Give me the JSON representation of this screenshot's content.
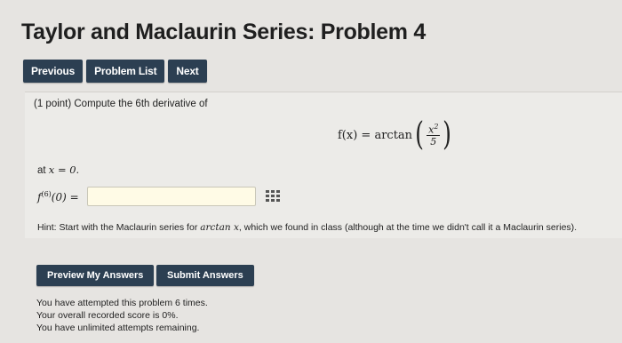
{
  "page": {
    "title": "Taylor and Maclaurin Series: Problem 4"
  },
  "nav": {
    "previous": "Previous",
    "problem_list": "Problem List",
    "next": "Next"
  },
  "problem": {
    "statement": "(1 point) Compute the 6th derivative of",
    "formula_lhs": "f(x) = arctan",
    "formula_num": "x",
    "formula_num_exp": "2",
    "formula_den": "5",
    "at_prefix": "at ",
    "at_var": "x = 0.",
    "answer_label_f": "f",
    "answer_label_exp": "(6)",
    "answer_label_rest": "(0) =",
    "answer_value": "",
    "hint_prefix": "Hint: Start with the Maclaurin series for ",
    "hint_math": "arctan x",
    "hint_suffix": ", which we found in class (although at the time we didn't call it a Maclaurin series)."
  },
  "actions": {
    "preview": "Preview My Answers",
    "submit": "Submit Answers"
  },
  "status": {
    "line1": "You have attempted this problem 6 times.",
    "line2": "Your overall recorded score is 0%.",
    "line3": "You have unlimited attempts remaining."
  },
  "icons": {
    "equation_editor": "grid-icon"
  },
  "colors": {
    "button_bg": "#2c3f52",
    "input_bg": "#fffbe6"
  }
}
